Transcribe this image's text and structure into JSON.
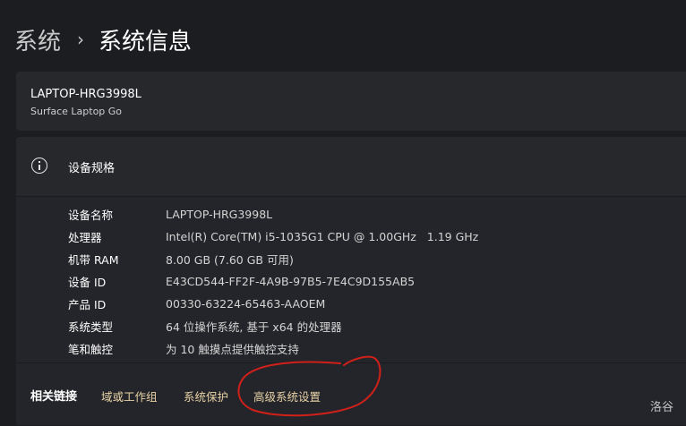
{
  "breadcrumb": {
    "parent": "系统",
    "separator": "›",
    "current": "系统信息"
  },
  "device": {
    "name": "LAPTOP-HRG3998L",
    "model": "Surface Laptop Go"
  },
  "specs": {
    "icon": "info-icon",
    "title": "设备规格",
    "rows": [
      {
        "label": "设备名称",
        "value": "LAPTOP-HRG3998L"
      },
      {
        "label": "处理器",
        "value": "Intel(R) Core(TM) i5-1035G1 CPU @ 1.00GHz   1.19 GHz"
      },
      {
        "label": "机带 RAM",
        "value": "8.00 GB (7.60 GB 可用)"
      },
      {
        "label": "设备 ID",
        "value": "E43CD544-FF2F-4A9B-97B5-7E4C9D155AB5"
      },
      {
        "label": "产品 ID",
        "value": "00330-63224-65463-AAOEM"
      },
      {
        "label": "系统类型",
        "value": "64 位操作系统, 基于 x64 的处理器"
      },
      {
        "label": "笔和触控",
        "value": "为 10 触摸点提供触控支持"
      }
    ]
  },
  "related": {
    "title": "相关链接",
    "links": [
      "域或工作组",
      "系统保护",
      "高级系统设置"
    ]
  },
  "watermark": "洛谷",
  "colors": {
    "background": "#1c1d21",
    "card": "#27282c",
    "link": "#e8d2a6",
    "annotation": "#d0201a"
  }
}
